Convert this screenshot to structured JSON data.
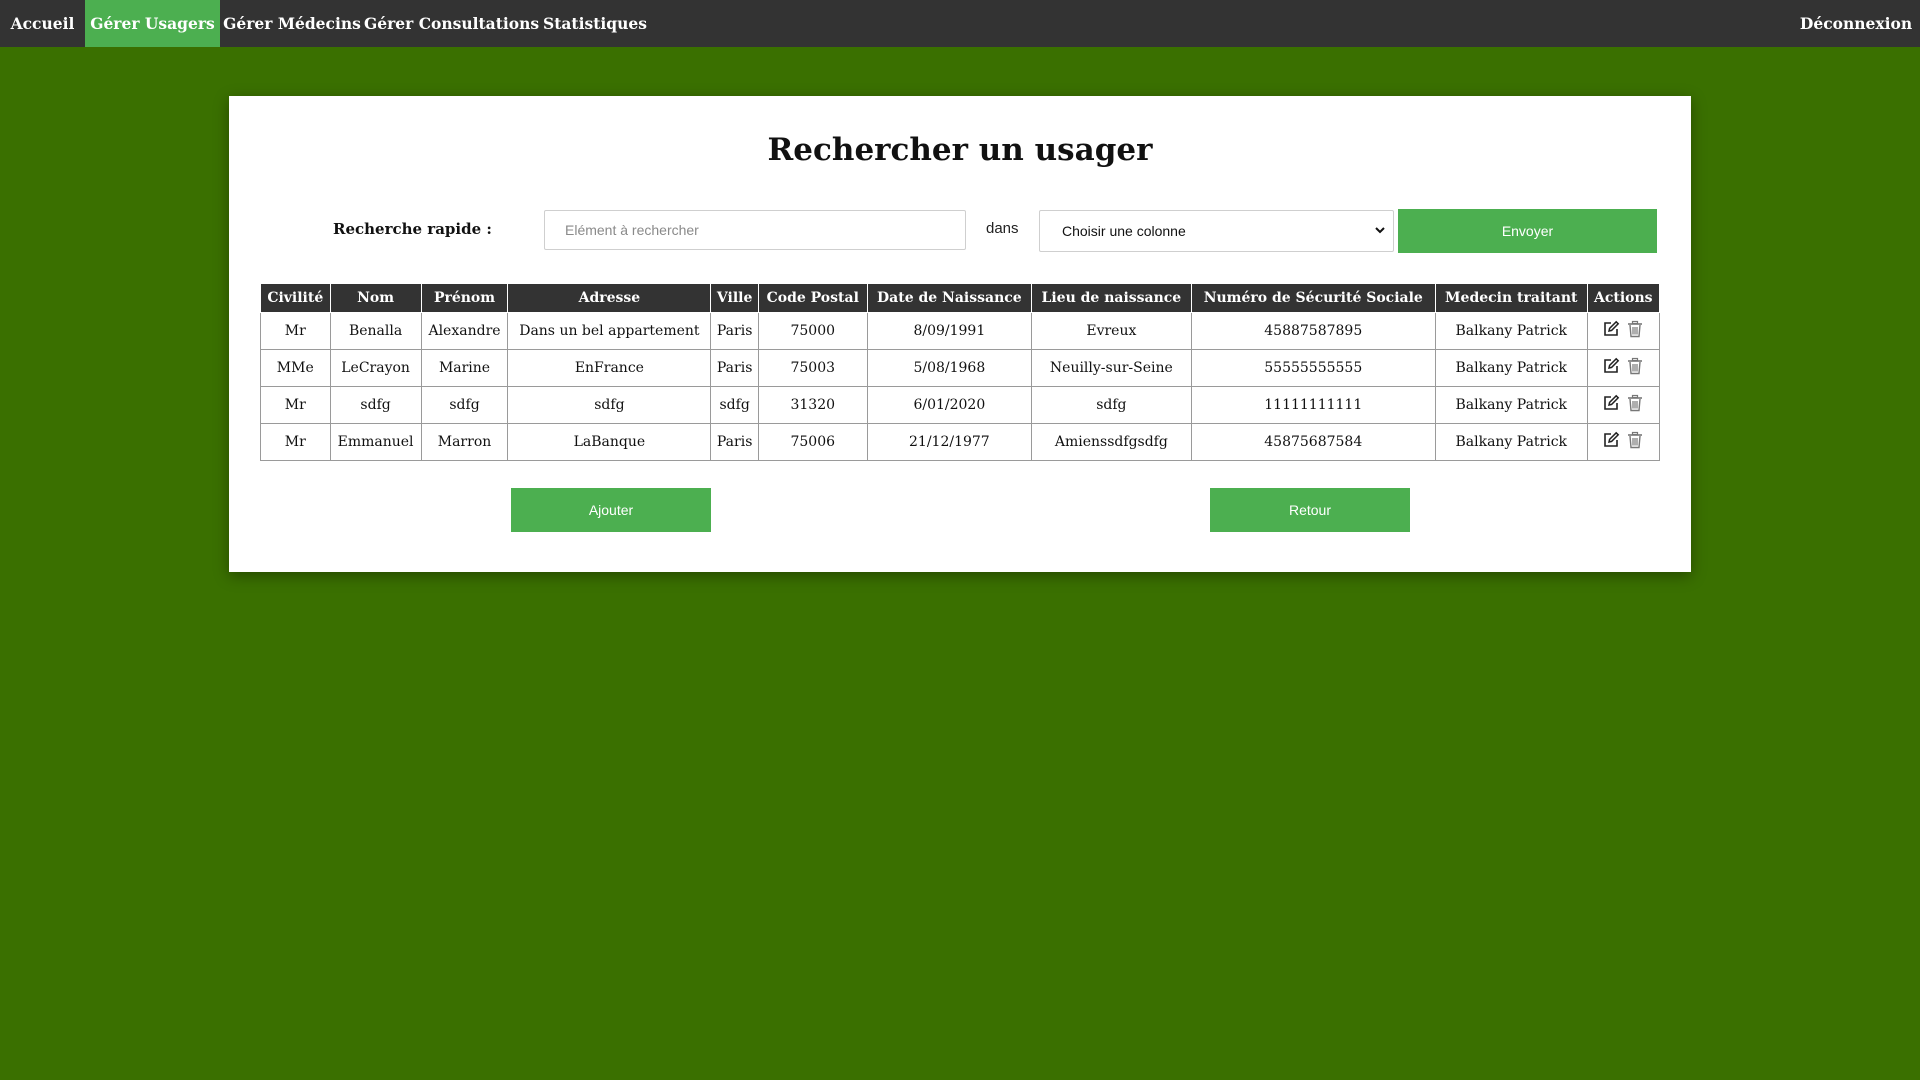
{
  "nav": {
    "items": [
      "Accueil",
      "Gérer Usagers",
      "Gérer Médecins",
      "Gérer Consultations",
      "Statistiques"
    ],
    "active": "Gérer Usagers",
    "logout": "Déconnexion"
  },
  "page": {
    "title": "Rechercher un usager"
  },
  "search": {
    "label": "Recherche rapide :",
    "placeholder": "Elément à rechercher",
    "in_label": "dans",
    "select_value": "Choisir une colonne",
    "submit": "Envoyer"
  },
  "table": {
    "headers": [
      "Civilité",
      "Nom",
      "Prénom",
      "Adresse",
      "Ville",
      "Code Postal",
      "Date de Naissance",
      "Lieu de naissance",
      "Numéro de Sécurité Sociale",
      "Medecin traitant",
      "Actions"
    ],
    "rows": [
      [
        "Mr",
        "Benalla",
        "Alexandre",
        "Dans un bel appartement",
        "Paris",
        "75000",
        "8/09/1991",
        "Evreux",
        "45887587895",
        "Balkany Patrick"
      ],
      [
        "MMe",
        "LeCrayon",
        "Marine",
        "EnFrance",
        "Paris",
        "75003",
        "5/08/1968",
        "Neuilly-sur-Seine",
        "55555555555",
        "Balkany Patrick"
      ],
      [
        "Mr",
        "sdfg",
        "sdfg",
        "sdfg",
        "sdfg",
        "31320",
        "6/01/2020",
        "sdfg",
        "11111111111",
        "Balkany Patrick"
      ],
      [
        "Mr",
        "Emmanuel",
        "Marron",
        "LaBanque",
        "Paris",
        "75006",
        "21/12/1977",
        "Amienssdfgsdfg",
        "45875687584",
        "Balkany Patrick"
      ]
    ],
    "row_actions": [
      "edit-icon",
      "trash-icon"
    ]
  },
  "buttons": {
    "add": "Ajouter",
    "back": "Retour"
  },
  "colors": {
    "background": "#3a7000",
    "navbar": "#333333",
    "accent": "#4caf50"
  }
}
